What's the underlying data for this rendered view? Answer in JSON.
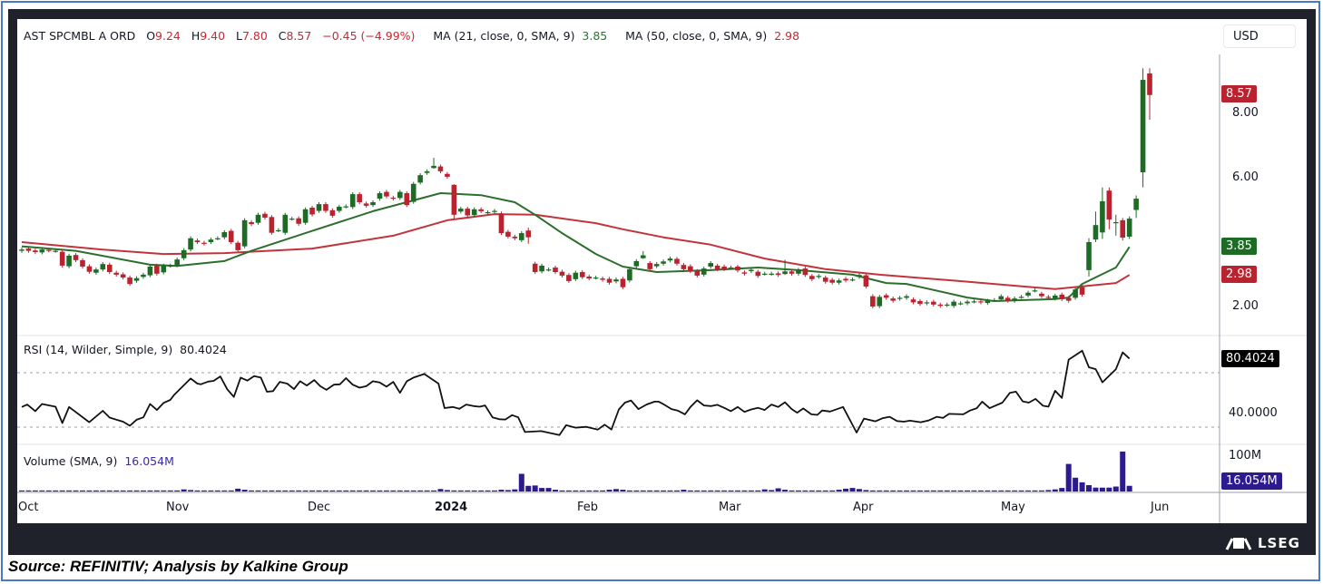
{
  "legend": {
    "symbol": "AST SPCMBL A ORD",
    "o_prefix": "O",
    "open": "9.24",
    "h_prefix": "H",
    "high": "9.40",
    "l_prefix": "L",
    "low": "7.80",
    "c_prefix": "C",
    "close": "8.57",
    "change": "−0.45 (−4.99%)",
    "ma21_label": "MA (21, close, 0, SMA, 9)",
    "ma21_value": "3.85",
    "ma50_label": "MA (50, close, 0, SMA, 9)",
    "ma50_value": "2.98",
    "rsi_label": "RSI (14, Wilder, Simple, 9)",
    "rsi_value": "80.4024",
    "volume_label": "Volume (SMA, 9)",
    "volume_value": "16.054M"
  },
  "currency_button": "USD",
  "price_axis": {
    "ticks": [
      "8.00",
      "6.00",
      "2.00"
    ],
    "last_price": "8.57",
    "ma21_tag": "3.85",
    "ma50_tag": "2.98"
  },
  "rsi_axis": {
    "tag": "80.4024",
    "tick": "40.0000"
  },
  "volume_axis": {
    "tick": "100M",
    "tag": "16.054M"
  },
  "time_axis": [
    "Oct",
    "Nov",
    "Dec",
    "2024",
    "Feb",
    "Mar",
    "Apr",
    "May",
    "Jun"
  ],
  "logo": "LSEG",
  "source": "Source: REFINITIV; Analysis by Kalkine Group",
  "colors": {
    "up": "#1e6b26",
    "down": "#b8232f",
    "ma21": "#2c6e2c",
    "ma50": "#c2343c",
    "rsi": "#111111",
    "volume": "#2e1a8f"
  },
  "chart_data": {
    "type": "candlestick",
    "title": "AST SPCMBL A ORD",
    "price_range": [
      1.5,
      9.6
    ],
    "rsi_levels": [
      70,
      30
    ],
    "candles_oc": [
      [
        3.73,
        3.77
      ],
      [
        3.8,
        3.73
      ],
      [
        3.74,
        3.69
      ],
      [
        3.68,
        3.77
      ],
      [
        3.76,
        3.74
      ],
      [
        3.73,
        3.73
      ],
      [
        3.7,
        3.27
      ],
      [
        3.25,
        3.58
      ],
      [
        3.6,
        3.44
      ],
      [
        3.44,
        3.24
      ],
      [
        3.25,
        3.08
      ],
      [
        3.05,
        3.15
      ],
      [
        3.15,
        3.32
      ],
      [
        3.3,
        3.07
      ],
      [
        3.05,
        2.99
      ],
      [
        3.0,
        2.9
      ],
      [
        2.9,
        2.7
      ],
      [
        2.8,
        2.88
      ],
      [
        2.92,
        2.99
      ],
      [
        2.97,
        3.24
      ],
      [
        3.27,
        3.02
      ],
      [
        3.06,
        3.27
      ],
      [
        3.27,
        3.27
      ],
      [
        3.28,
        3.46
      ],
      [
        3.5,
        3.75
      ],
      [
        3.77,
        4.12
      ],
      [
        4.05,
        4.0
      ],
      [
        3.98,
        3.95
      ],
      [
        4.0,
        4.08
      ],
      [
        4.12,
        4.12
      ],
      [
        4.15,
        4.31
      ],
      [
        4.35,
        4.0
      ],
      [
        3.98,
        3.75
      ],
      [
        3.87,
        4.68
      ],
      [
        4.62,
        4.56
      ],
      [
        4.6,
        4.85
      ],
      [
        4.88,
        4.76
      ],
      [
        4.78,
        4.29
      ],
      [
        4.37,
        4.37
      ],
      [
        4.29,
        4.85
      ],
      [
        4.73,
        4.73
      ],
      [
        4.74,
        4.57
      ],
      [
        4.6,
        5.02
      ],
      [
        5.07,
        4.86
      ],
      [
        4.97,
        5.18
      ],
      [
        5.18,
        4.97
      ],
      [
        4.99,
        4.82
      ],
      [
        4.97,
        5.1
      ],
      [
        5.11,
        5.11
      ],
      [
        5.09,
        5.49
      ],
      [
        5.49,
        5.24
      ],
      [
        5.2,
        5.13
      ],
      [
        5.15,
        5.24
      ],
      [
        5.35,
        5.52
      ],
      [
        5.56,
        5.42
      ],
      [
        5.38,
        5.35
      ],
      [
        5.37,
        5.56
      ],
      [
        5.52,
        5.15
      ],
      [
        5.25,
        5.81
      ],
      [
        5.85,
        6.08
      ],
      [
        6.15,
        6.2
      ],
      [
        6.3,
        6.37,
        6.62,
        6.28
      ],
      [
        6.35,
        6.2
      ],
      [
        6.12,
        6.03
      ],
      [
        5.78,
        4.85,
        5.8,
        4.72
      ],
      [
        4.95,
        5.04
      ],
      [
        5.04,
        4.83
      ],
      [
        4.84,
        5.02
      ],
      [
        5.02,
        4.96
      ],
      [
        4.93,
        4.93
      ],
      [
        4.95,
        4.97
      ],
      [
        4.89,
        4.28
      ],
      [
        4.32,
        4.17
      ],
      [
        4.17,
        4.12
      ],
      [
        4.06,
        4.28
      ],
      [
        4.36,
        4.15,
        4.45,
        3.95
      ],
      [
        3.33,
        3.07
      ],
      [
        3.09,
        3.27
      ],
      [
        3.15,
        3.15
      ],
      [
        3.21,
        3.07
      ],
      [
        3.08,
        2.96
      ],
      [
        2.98,
        2.79
      ],
      [
        2.85,
        3.05
      ],
      [
        3.07,
        2.91
      ],
      [
        2.93,
        2.87
      ],
      [
        2.9,
        2.9
      ],
      [
        2.87,
        2.83
      ],
      [
        2.86,
        2.74
      ],
      [
        2.78,
        2.84
      ],
      [
        2.86,
        2.6
      ],
      [
        2.81,
        3.16
      ],
      [
        3.25,
        3.41
      ],
      [
        3.5,
        3.59,
        3.72,
        3.48
      ],
      [
        3.35,
        3.16
      ],
      [
        3.25,
        3.32
      ],
      [
        3.33,
        3.4
      ],
      [
        3.43,
        3.49
      ],
      [
        3.48,
        3.33
      ],
      [
        3.29,
        3.16
      ],
      [
        3.25,
        3.1
      ],
      [
        3.1,
        2.96
      ],
      [
        2.99,
        3.18
      ],
      [
        3.24,
        3.35
      ],
      [
        3.27,
        3.16
      ],
      [
        3.24,
        3.16
      ],
      [
        3.21,
        3.21
      ],
      [
        3.24,
        3.12
      ],
      [
        3.06,
        3.02
      ],
      [
        3.1,
        3.14
      ],
      [
        3.08,
        2.95
      ],
      [
        3.02,
        3.02
      ],
      [
        3.02,
        3.02
      ],
      [
        3.03,
        2.98
      ],
      [
        3.01,
        3.09,
        3.45,
        2.98
      ],
      [
        3.09,
        3.02
      ],
      [
        3.02,
        3.14
      ],
      [
        3.18,
        2.98
      ],
      [
        2.95,
        2.85
      ],
      [
        2.92,
        2.95
      ],
      [
        2.9,
        2.77
      ],
      [
        2.83,
        2.74
      ],
      [
        2.74,
        2.81
      ],
      [
        2.86,
        2.81
      ],
      [
        2.84,
        2.84
      ],
      [
        2.92,
        2.98
      ],
      [
        2.97,
        2.62
      ],
      [
        2.32,
        2.0
      ],
      [
        2.01,
        2.3
      ],
      [
        2.35,
        2.27
      ],
      [
        2.25,
        2.18
      ],
      [
        2.24,
        2.27
      ],
      [
        2.27,
        2.32
      ],
      [
        2.22,
        2.13
      ],
      [
        2.17,
        2.08
      ],
      [
        2.1,
        2.13
      ],
      [
        2.15,
        2.06
      ],
      [
        2.06,
        2.02
      ],
      [
        2.04,
        2.06
      ],
      [
        2.02,
        2.15
      ],
      [
        2.1,
        2.1
      ],
      [
        2.1,
        2.15
      ],
      [
        2.16,
        2.16
      ],
      [
        2.16,
        2.13
      ],
      [
        2.11,
        2.18
      ],
      [
        2.2,
        2.2
      ],
      [
        2.22,
        2.32
      ],
      [
        2.27,
        2.18
      ],
      [
        2.18,
        2.25
      ],
      [
        2.3,
        2.3
      ],
      [
        2.34,
        2.43
      ],
      [
        2.5,
        2.5
      ],
      [
        2.4,
        2.32
      ],
      [
        2.3,
        2.27
      ],
      [
        2.25,
        2.34
      ],
      [
        2.37,
        2.23
      ],
      [
        2.27,
        2.18
      ],
      [
        2.27,
        2.53
      ],
      [
        2.6,
        2.37
      ],
      [
        3.13,
        4.0,
        4.12,
        2.93
      ],
      [
        4.08,
        4.53,
        4.95,
        4.0
      ],
      [
        4.3,
        5.27,
        5.7,
        4.1
      ],
      [
        5.6,
        4.7,
        5.7,
        4.4
      ],
      [
        4.62,
        4.62,
        4.85,
        4.2
      ],
      [
        4.68,
        4.14,
        4.75,
        4.05
      ],
      [
        4.17,
        4.73,
        4.8,
        4.1
      ],
      [
        5.0,
        5.35,
        5.45,
        4.75
      ],
      [
        6.17,
        9.04,
        9.4,
        5.7
      ],
      [
        9.24,
        8.57,
        9.4,
        7.8
      ]
    ],
    "ma21_points": [
      [
        0,
        3.87
      ],
      [
        8,
        3.73
      ],
      [
        19,
        3.3
      ],
      [
        23,
        3.26
      ],
      [
        30,
        3.41
      ],
      [
        34,
        3.73
      ],
      [
        43,
        4.35
      ],
      [
        52,
        4.96
      ],
      [
        62,
        5.52
      ],
      [
        68,
        5.46
      ],
      [
        73,
        5.24
      ],
      [
        76,
        4.85
      ],
      [
        80,
        4.28
      ],
      [
        85,
        3.63
      ],
      [
        89,
        3.24
      ],
      [
        94,
        3.07
      ],
      [
        102,
        3.13
      ],
      [
        109,
        3.21
      ],
      [
        115,
        3.13
      ],
      [
        123,
        2.99
      ],
      [
        128,
        2.73
      ],
      [
        131,
        2.7
      ],
      [
        140,
        2.28
      ],
      [
        144,
        2.17
      ],
      [
        153,
        2.23
      ],
      [
        155,
        2.28
      ],
      [
        157,
        2.7
      ],
      [
        162,
        3.21
      ],
      [
        164,
        3.85
      ]
    ],
    "ma50_points": [
      [
        0,
        4.0
      ],
      [
        12,
        3.77
      ],
      [
        21,
        3.63
      ],
      [
        30,
        3.66
      ],
      [
        43,
        3.8
      ],
      [
        55,
        4.2
      ],
      [
        63,
        4.68
      ],
      [
        70,
        4.87
      ],
      [
        76,
        4.85
      ],
      [
        85,
        4.59
      ],
      [
        89,
        4.4
      ],
      [
        95,
        4.15
      ],
      [
        102,
        3.92
      ],
      [
        110,
        3.49
      ],
      [
        119,
        3.16
      ],
      [
        127,
        2.99
      ],
      [
        139,
        2.79
      ],
      [
        153,
        2.54
      ],
      [
        162,
        2.73
      ],
      [
        164,
        2.98
      ]
    ],
    "rsi_points": [
      [
        0,
        44.8
      ],
      [
        0.8,
        46.6
      ],
      [
        2,
        41.7
      ],
      [
        3,
        47
      ],
      [
        5,
        45
      ],
      [
        6,
        33
      ],
      [
        7,
        44.8
      ],
      [
        10,
        33.6
      ],
      [
        12,
        42
      ],
      [
        13,
        37
      ],
      [
        15,
        34
      ],
      [
        16,
        31
      ],
      [
        17,
        35.4
      ],
      [
        18,
        37.2
      ],
      [
        19,
        47
      ],
      [
        20,
        42.6
      ],
      [
        21,
        47.8
      ],
      [
        22,
        50
      ],
      [
        22.5,
        53.4
      ],
      [
        25,
        65.7
      ],
      [
        26,
        62
      ],
      [
        26.5,
        61.5
      ],
      [
        27.6,
        63.5
      ],
      [
        28.4,
        64
      ],
      [
        29.4,
        67.3
      ],
      [
        30.4,
        57.9
      ],
      [
        31.4,
        52.2
      ],
      [
        32.4,
        66.4
      ],
      [
        33.4,
        64.2
      ],
      [
        34.4,
        67.5
      ],
      [
        35.4,
        66.4
      ],
      [
        36.3,
        56
      ],
      [
        37.2,
        56.5
      ],
      [
        38.2,
        63.3
      ],
      [
        39.3,
        62
      ],
      [
        40.3,
        57.9
      ],
      [
        41.2,
        63.7
      ],
      [
        42.2,
        60.6
      ],
      [
        43.3,
        64.6
      ],
      [
        44.2,
        60.1
      ],
      [
        45.1,
        57.4
      ],
      [
        46.2,
        61.2
      ],
      [
        47.1,
        61.5
      ],
      [
        48,
        66
      ],
      [
        49,
        61.2
      ],
      [
        50,
        59
      ],
      [
        51,
        60.1
      ],
      [
        52,
        63.7
      ],
      [
        53,
        62.8
      ],
      [
        54,
        59.7
      ],
      [
        55,
        63.3
      ],
      [
        56,
        55.2
      ],
      [
        57,
        63.7
      ],
      [
        58,
        66.4
      ],
      [
        59.6,
        69.1
      ],
      [
        61.7,
        62
      ],
      [
        62.6,
        44
      ],
      [
        63.8,
        44.8
      ],
      [
        64.8,
        43.5
      ],
      [
        65.8,
        46.6
      ],
      [
        66.9,
        45.5
      ],
      [
        67.8,
        45
      ],
      [
        68.6,
        45.9
      ],
      [
        69.7,
        37.2
      ],
      [
        70.7,
        35.8
      ],
      [
        71.6,
        35.6
      ],
      [
        72.6,
        38.8
      ],
      [
        73.5,
        37.2
      ],
      [
        74.5,
        26.4
      ],
      [
        76.9,
        27.1
      ],
      [
        79.6,
        24.2
      ],
      [
        80.6,
        31.4
      ],
      [
        82,
        29.6
      ],
      [
        83.6,
        30.2
      ],
      [
        85.3,
        28.2
      ],
      [
        86.3,
        31.8
      ],
      [
        87.3,
        28.2
      ],
      [
        88.4,
        43
      ],
      [
        89.3,
        48
      ],
      [
        90.2,
        49.6
      ],
      [
        91.3,
        43.3
      ],
      [
        92.5,
        46.6
      ],
      [
        93.7,
        48.7
      ],
      [
        94.3,
        48.7
      ],
      [
        95.1,
        46.6
      ],
      [
        96.2,
        43.3
      ],
      [
        97.1,
        42.2
      ],
      [
        98.2,
        39.4
      ],
      [
        99,
        44.8
      ],
      [
        100,
        49.7
      ],
      [
        101,
        45.9
      ],
      [
        102.1,
        45.5
      ],
      [
        103,
        46.4
      ],
      [
        104.1,
        43.9
      ],
      [
        105,
        41.7
      ],
      [
        106,
        44.8
      ],
      [
        107,
        41.2
      ],
      [
        108,
        43
      ],
      [
        109,
        44.2
      ],
      [
        110,
        42.6
      ],
      [
        111,
        46.6
      ],
      [
        112,
        44.8
      ],
      [
        113,
        48.3
      ],
      [
        114,
        43.3
      ],
      [
        114.8,
        40.6
      ],
      [
        115.7,
        43.7
      ],
      [
        116.9,
        39.4
      ],
      [
        117.8,
        39
      ],
      [
        118.5,
        42.2
      ],
      [
        119.7,
        41.5
      ],
      [
        121.6,
        44.8
      ],
      [
        123.6,
        26
      ],
      [
        124.7,
        36.3
      ],
      [
        126.4,
        34.3
      ],
      [
        127.4,
        36.5
      ],
      [
        128.5,
        37.6
      ],
      [
        129.6,
        34.5
      ],
      [
        130.6,
        34
      ],
      [
        131.5,
        34.7
      ],
      [
        133.1,
        33.6
      ],
      [
        134.3,
        34.9
      ],
      [
        135.5,
        37.6
      ],
      [
        136.4,
        36.7
      ],
      [
        137.3,
        39.7
      ],
      [
        139.4,
        39.4
      ],
      [
        140.4,
        42.2
      ],
      [
        141.4,
        43.9
      ],
      [
        142.2,
        48.7
      ],
      [
        143.3,
        43.9
      ],
      [
        145.2,
        48
      ],
      [
        146.3,
        55.2
      ],
      [
        147.2,
        56.1
      ],
      [
        148.2,
        48.9
      ],
      [
        149.1,
        48
      ],
      [
        150.1,
        50.7
      ],
      [
        151.2,
        45.7
      ],
      [
        152,
        45
      ],
      [
        153,
        56.7
      ],
      [
        154,
        51.5
      ],
      [
        155,
        79.6
      ],
      [
        157,
        86.2
      ],
      [
        158,
        74
      ],
      [
        159,
        72.6
      ],
      [
        160,
        62.9
      ],
      [
        162,
        72.6
      ],
      [
        163,
        84.9
      ],
      [
        164,
        80.4
      ]
    ],
    "volume_millions": [
      3,
      3,
      3,
      3,
      3,
      3,
      3,
      3,
      3,
      3,
      3,
      3,
      3,
      3,
      3,
      3,
      3,
      3,
      3,
      3,
      3,
      3,
      3,
      3,
      6,
      4,
      3,
      3,
      3,
      3,
      3,
      3,
      8,
      5,
      3,
      3,
      3,
      3,
      3,
      3,
      3,
      3,
      3,
      3,
      3,
      3,
      3,
      3,
      3,
      3,
      3,
      3,
      3,
      3,
      3,
      3,
      3,
      3,
      3,
      3,
      3,
      3,
      7,
      4,
      3,
      3,
      3,
      3,
      3,
      3,
      3,
      5,
      4,
      6,
      50,
      16,
      17,
      10,
      10,
      5,
      3,
      3,
      3,
      3,
      3,
      3,
      3,
      5,
      7,
      5,
      3,
      3,
      3,
      3,
      3,
      3,
      3,
      3,
      5,
      3,
      3,
      3,
      3,
      3,
      3,
      3,
      3,
      3,
      3,
      3,
      6,
      4,
      9,
      5,
      3,
      3,
      3,
      3,
      3,
      3,
      3,
      5,
      8,
      10,
      7,
      4,
      3,
      3,
      3,
      3,
      3,
      3,
      3,
      3,
      3,
      3,
      3,
      3,
      3,
      3,
      3,
      3,
      3,
      3,
      3,
      3,
      3,
      3,
      3,
      3,
      3,
      3,
      4,
      6,
      10,
      78,
      39,
      26,
      18,
      11,
      11,
      11,
      14,
      113,
      16.054
    ]
  }
}
